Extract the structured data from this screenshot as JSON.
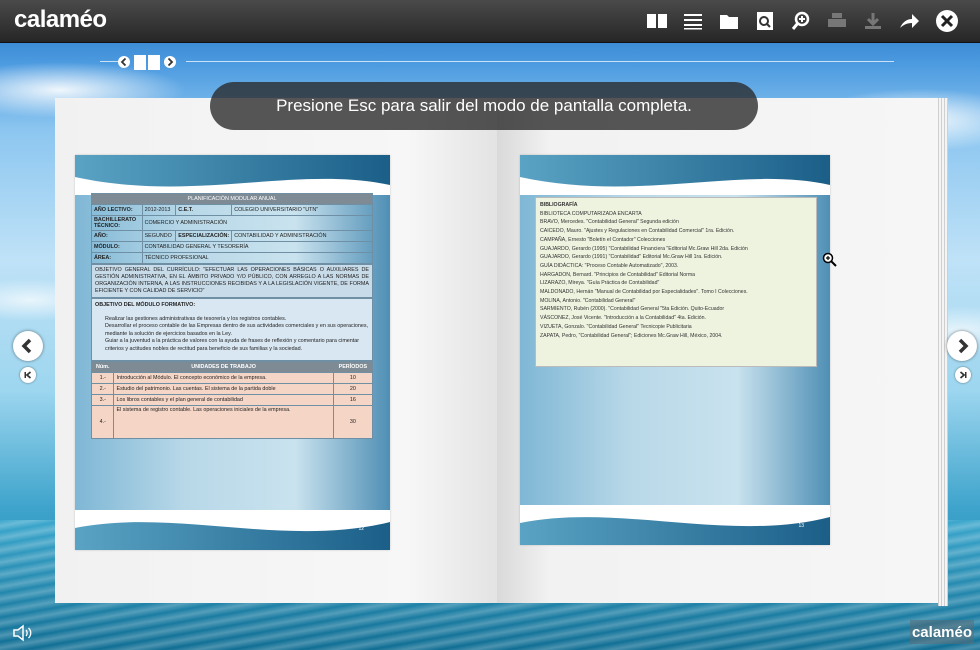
{
  "app": {
    "logo": "calaméo",
    "footer_logo": "calaméo"
  },
  "toolbar": {
    "icons": [
      "book-icon",
      "list-icon",
      "single-page-icon",
      "search-page-icon",
      "zoom-icon",
      "print-icon",
      "download-icon",
      "share-icon",
      "close-icon"
    ]
  },
  "overlay": {
    "message": "Presione Esc para salir del modo de pantalla completa."
  },
  "left_page": {
    "title": "PLANIFICACIÓN MODULAR ANUAL",
    "rows": [
      {
        "k1": "AÑO LECTIVO:",
        "v1": "2012-2013",
        "k2": "C.E.T.",
        "v2": "COLEGIO UNIVERSITARIO \"UTN\""
      },
      {
        "k1": "BACHILLERATO TÉCNICO:",
        "v1": "COMERCIO Y ADMINISTRACIÓN"
      },
      {
        "k1": "AÑO:",
        "v1": "SEGUNDO",
        "k2": "ESPECIALIZACIÓN:",
        "v2": "CONTABILIDAD Y ADMINISTRACIÓN"
      },
      {
        "k1": "MÓDULO:",
        "v1": "CONTABILIDAD GENERAL Y TESORERÍA"
      },
      {
        "k1": "ÁREA:",
        "v1": "TÉCNICO PROFESIONAL"
      }
    ],
    "objective_general": "OBJETIVO GENERAL DEL CURRÍCULO: \"EFECTUAR LAS OPERACIONES BÁSICAS O AUXILIARES DE GESTIÓN ADMINISTRATIVA, EN EL ÁMBITO PRIVADO Y/O PÚBLICO, CON ARREGLO A LAS NORMAS DE ORGANIZACIÓN INTERNA, A LAS INSTRUCCIONES RECIBIDAS Y A LA LEGISLACIÓN VIGENTE, DE FORMA EFICIENTE Y CON CALIDAD DE SERVICIO\"",
    "objective_module_title": "OBJETIVO DEL MÓDULO FORMATIVO:",
    "objective_module_items": [
      "Realizar las gestiones administrativas de tesorería y los registros contables.",
      "Desarrollar el proceso contable de las Empresas dentro de sus actividades comerciales y en sus operaciones, mediante la solución de ejercicios basados en la Ley.",
      "Guiar a la juventud a la práctica de valores con la ayuda de frases de reflexión y comentario para cimentar criterios y actitudes nobles de rectitud para beneficio de sus familias y la sociedad."
    ],
    "units_header": {
      "num": "Núm.",
      "unit": "UNIDADES DE TRABAJO",
      "periods": "PERÍODOS"
    },
    "units": [
      {
        "num": "1.-",
        "unit": "Introducción al Módulo. El concepto económico de la empresa.",
        "periods": "10"
      },
      {
        "num": "2.-",
        "unit": "Estudio del patrimonio. Las cuentas. El sistema de la partida doble",
        "periods": "20"
      },
      {
        "num": "3.-",
        "unit": "Los libros contables y el plan general de contabilidad",
        "periods": "16"
      },
      {
        "num": "4.-",
        "unit": "El sistema de registro contable. Las operaciones iniciales de la empresa.",
        "periods": "30"
      }
    ],
    "page_number": "12"
  },
  "right_page": {
    "title": "BIBLIOGRAFÍA",
    "items": [
      "BIBLIOTECA COMPUTARIZADA ENCARTA",
      "BRAVO, Mercedes. \"Contabilidad General\" Segunda edición",
      "CAICEDO, Mauro. \"Ajustes y Regulaciones en Contabilidad Comercial\" 1ra. Edición.",
      "CAMPAÑA, Ernesto \"Boletín el Contador\" Colecciones",
      "GUAJARDO, Gerardo (1995) \"Contabilidad Financiera \"Editorial Mc.Graw Hill 2da. Edición",
      "GUAJARDO, Gerardo (1991) \"Contabilidad\" Editorial Mc.Graw Hill 1ra. Edición.",
      "GUÍA DIDÁCTICA: \"Proceso Contable Automatizado\", 2003.",
      "HARGADON, Bernard. \"Principios de Contabilidad\" Editorial Norma",
      "LIZARAZO, Mireya. \"Guía Práctica de Contabilidad\"",
      "MALDONADO, Hernán \"Manual de Contabilidad por Especialidades\". Tomo I Colecciones.",
      "MOLINA, Antonio. \"Contabilidad General\"",
      "SARMIENTO, Rubén (2000). \"Contabilidad General \"5ta Edición. Quito-Ecuador",
      "VÁSCONEZ, José Vicente. \"Introducción a la Contabilidad\" 4ta. Edición.",
      "VIZUETA, Gonzalo. \"Contabilidad General\" Tecnicopie Publicitaria",
      "ZAPATA, Pedro, \"Contabilidad General\"; Ediciones Mc.Graw Hill, México, 2004."
    ],
    "page_number": "13"
  }
}
